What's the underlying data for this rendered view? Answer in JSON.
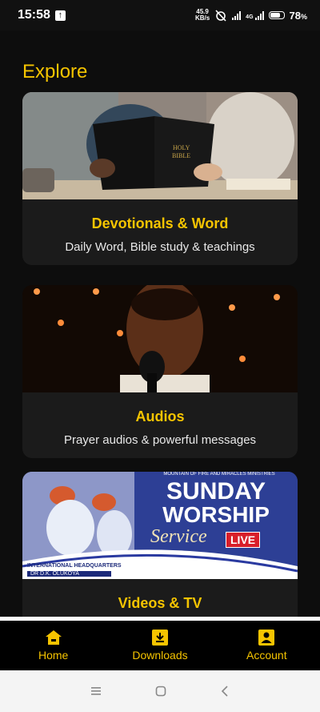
{
  "status": {
    "time": "15:58",
    "net_speed_value": "45.9",
    "net_speed_unit": "KB/s",
    "network_type": "4G",
    "battery_percent": "78",
    "battery_suffix": "%"
  },
  "page": {
    "title": "Explore"
  },
  "cards": [
    {
      "title": "Devotionals & Word",
      "subtitle": "Daily Word, Bible study & teachings",
      "image": "bible-reading-photo"
    },
    {
      "title": "Audios",
      "subtitle": "Prayer audios & powerful messages",
      "image": "preacher-microphone-photo"
    },
    {
      "title": "Videos & TV",
      "subtitle": "",
      "image": "sunday-worship-banner",
      "banner": {
        "org": "MOUNTAIN OF FIRE AND MIRACLES MINISTRIES",
        "line1": "SUNDAY",
        "line2": "WORSHIP",
        "line3": "Service",
        "live": "LIVE",
        "hq": "INTERNATIONAL HEADQUARTERS",
        "pastor": "DR D.K. OLUKOYA"
      }
    }
  ],
  "bottom_nav": [
    {
      "label": "Home",
      "icon": "home-icon"
    },
    {
      "label": "Downloads",
      "icon": "download-icon"
    },
    {
      "label": "Account",
      "icon": "account-icon"
    }
  ],
  "colors": {
    "accent": "#f5c400",
    "background": "#0d0d0d",
    "card": "#1b1b1b"
  }
}
